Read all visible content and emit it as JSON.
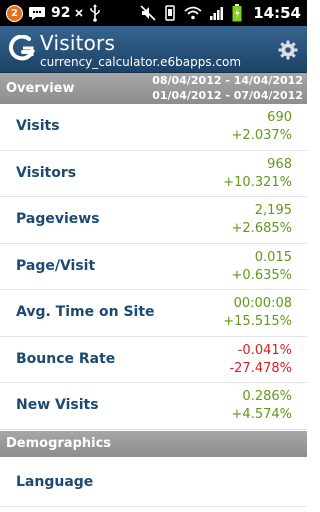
{
  "status_bar": {
    "notification_count": "2",
    "battery_text": "92",
    "time": "14:54"
  },
  "header": {
    "title": "Visitors",
    "subtitle": "currency_calculator.e6bapps.com"
  },
  "overview": {
    "title": "Overview",
    "date_range_1": "08/04/2012 - 14/04/2012",
    "date_range_2": "01/04/2012 - 07/04/2012"
  },
  "metrics": [
    {
      "label": "Visits",
      "value": "690",
      "change": "+2.037%",
      "trend": "up"
    },
    {
      "label": "Visitors",
      "value": "968",
      "change": "+10.321%",
      "trend": "up"
    },
    {
      "label": "Pageviews",
      "value": "2,195",
      "change": "+2.685%",
      "trend": "up"
    },
    {
      "label": "Page/Visit",
      "value": "0.015",
      "change": "+0.635%",
      "trend": "up"
    },
    {
      "label": "Avg. Time on Site",
      "value": "00:00:08",
      "change": "+15.515%",
      "trend": "up"
    },
    {
      "label": "Bounce Rate",
      "value": "-0.041%",
      "change": "-27.478%",
      "trend": "down"
    },
    {
      "label": "New Visits",
      "value": "0.286%",
      "change": "+4.574%",
      "trend": "up"
    }
  ],
  "demographics": {
    "title": "Demographics",
    "items": [
      {
        "label": "Language"
      }
    ]
  },
  "colors": {
    "header": "#2b557c",
    "label": "#1c4a73",
    "positive": "#5f9a1a",
    "negative": "#d42222",
    "section": "#999999"
  }
}
